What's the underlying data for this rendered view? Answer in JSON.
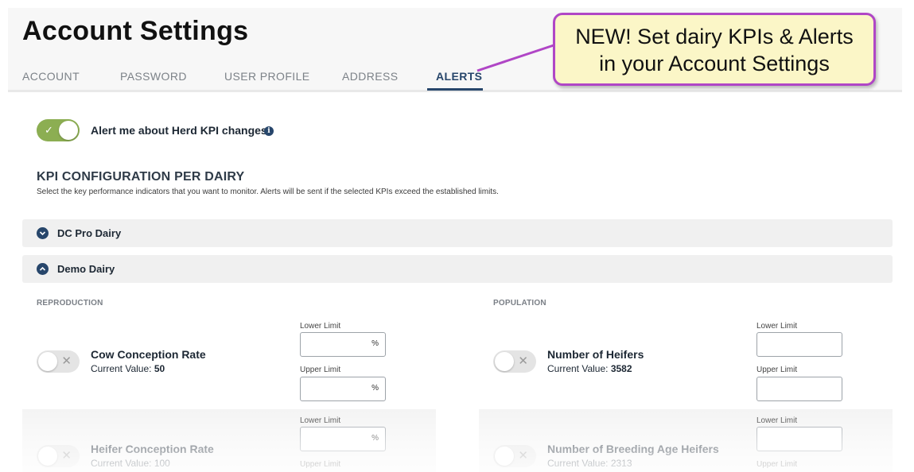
{
  "page_title": "Account Settings",
  "tabs": [
    {
      "label": "ACCOUNT"
    },
    {
      "label": "PASSWORD"
    },
    {
      "label": "USER PROFILE"
    },
    {
      "label": "ADDRESS"
    },
    {
      "label": "ALERTS",
      "active": true
    }
  ],
  "callout": {
    "line1": "NEW! Set dairy KPIs & Alerts",
    "line2": "in your Account Settings"
  },
  "alert_toggle": {
    "label": "Alert me about Herd KPI changes",
    "state": "on",
    "info_icon": "i"
  },
  "kpi_section": {
    "title": "KPI CONFIGURATION PER DAIRY",
    "description": "Select the key performance indicators that you want to monitor. Alerts will be sent if the selected KPIs exceed the established limits."
  },
  "dairies": [
    {
      "name": "DC Pro Dairy",
      "expanded": false
    },
    {
      "name": "Demo Dairy",
      "expanded": true
    }
  ],
  "reproduction": {
    "heading": "REPRODUCTION",
    "kpis": [
      {
        "name": "Cow Conception Rate",
        "current_label": "Current Value:",
        "current_value": "50",
        "lower_label": "Lower Limit",
        "upper_label": "Upper Limit",
        "unit": "%",
        "enabled": false
      },
      {
        "name": "Heifer Conception Rate",
        "current_label": "Current Value:",
        "current_value": "100",
        "lower_label": "Lower Limit",
        "upper_label": "Upper Limit",
        "unit": "%",
        "enabled": false
      }
    ]
  },
  "population": {
    "heading": "POPULATION",
    "kpis": [
      {
        "name": "Number of Heifers",
        "current_label": "Current Value:",
        "current_value": "3582",
        "lower_label": "Lower Limit",
        "upper_label": "Upper Limit",
        "unit": "",
        "enabled": false
      },
      {
        "name": "Number of Breeding Age Heifers",
        "current_label": "Current Value:",
        "current_value": "2313",
        "lower_label": "Lower Limit",
        "upper_label": "Upper Limit",
        "unit": "",
        "enabled": false
      }
    ]
  },
  "icons": {
    "toggle_on_mark": "✓",
    "toggle_off_mark": "✕",
    "chevron_down": "chevron-down-icon",
    "chevron_up": "chevron-up-icon"
  },
  "colors": {
    "primary": "#27466b",
    "toggle_on": "#8cae52",
    "callout_border": "#b046c6",
    "callout_bg": "#fbf6c7"
  }
}
